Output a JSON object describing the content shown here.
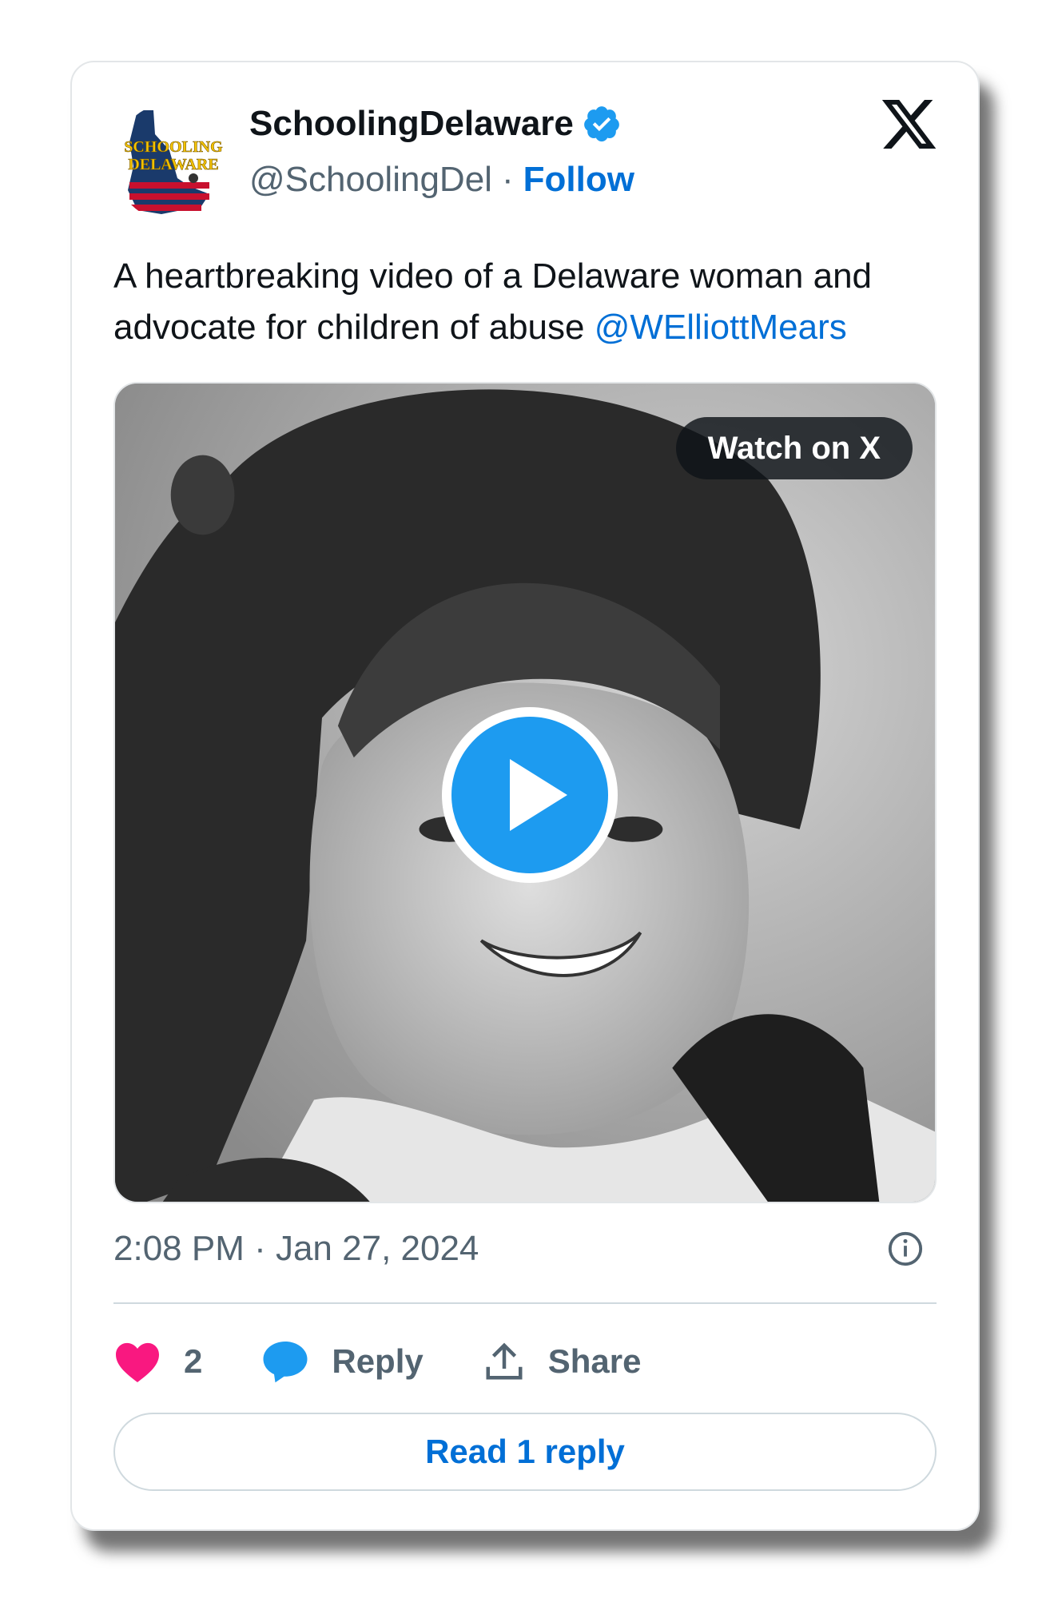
{
  "author": {
    "display_name": "SchoolingDelaware",
    "handle": "@SchoolingDel",
    "separator": "·",
    "follow_label": "Follow",
    "avatar_text_line1": "SCHOOLING",
    "avatar_text_line2": "DELAWARE"
  },
  "tweet": {
    "text": "A heartbreaking video of a Delaware woman and advocate for children of abuse ",
    "mention": "@WElliottMears"
  },
  "media": {
    "watch_label": "Watch on X",
    "play_icon": "play-icon"
  },
  "meta": {
    "timestamp": "2:08 PM · Jan 27, 2024"
  },
  "actions": {
    "like_count": "2",
    "reply_label": "Reply",
    "share_label": "Share"
  },
  "read_reply_label": "Read 1 reply",
  "colors": {
    "link_blue": "#006fd6",
    "verified_blue": "#1d9bf0",
    "like_pink": "#f91880",
    "muted": "#536471"
  }
}
